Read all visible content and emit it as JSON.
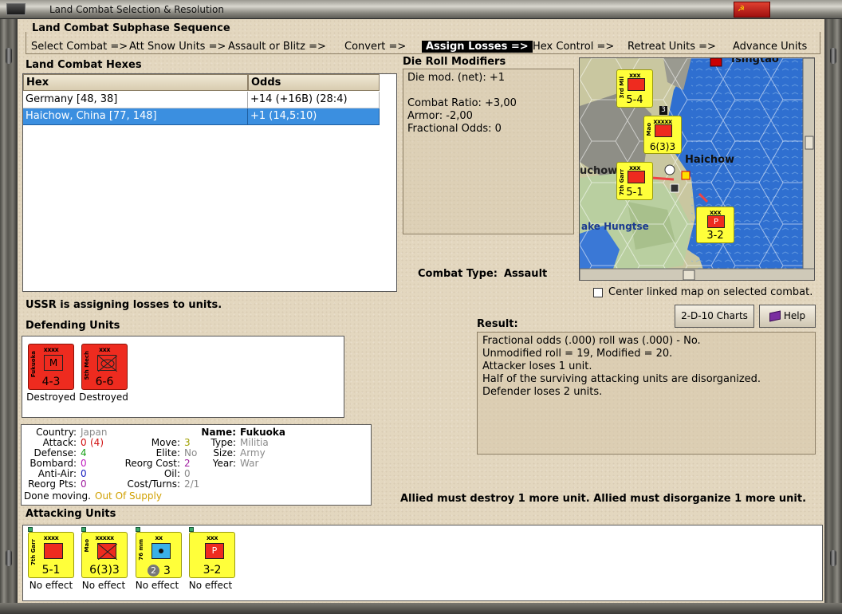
{
  "window": {
    "title": "Land Combat Selection & Resolution",
    "close_glyph": "☭"
  },
  "subphase": {
    "title": "Land Combat Subphase Sequence",
    "steps": [
      "Select Combat =>",
      "Att Snow Units =>",
      "Assault or Blitz =>",
      "Convert =>",
      "Assign Losses =>",
      "Hex Control =>",
      "Retreat Units =>",
      "Advance Units"
    ],
    "active_index": 4
  },
  "hexes": {
    "title": "Land Combat Hexes",
    "columns": [
      "Hex",
      "Odds"
    ],
    "rows": [
      {
        "hex": "Germany [48, 38]",
        "odds": "+14 (+16B) (28:4)"
      },
      {
        "hex": "Haichow, China [77, 148]",
        "odds": "+1 (14,5:10)"
      }
    ],
    "selected_row": 1
  },
  "die_roll": {
    "title": "Die Roll Modifiers",
    "lines": [
      "Die mod. (net): +1",
      "Combat Ratio: +3,00",
      "Armor: -2,00",
      "Fractional Odds: 0"
    ]
  },
  "combat_type": {
    "label": "Combat Type:",
    "value": "Assault"
  },
  "map": {
    "labels": {
      "tsingtao": "Tsingtao",
      "haichow": "Haichow",
      "uchow": "uchow",
      "hungtse": "ake Hungtse"
    },
    "units": [
      {
        "size": "xxx",
        "name": "3rd Mil",
        "str": "5-4"
      },
      {
        "size": "xxxxx",
        "name": "Mao",
        "str": "6(3)3",
        "badge": "3"
      },
      {
        "size": "xxx",
        "name": "7th Garr",
        "str": "5-1"
      },
      {
        "size": "xxx",
        "name": "",
        "str": "3-2",
        "letter": "P"
      }
    ]
  },
  "center_map": {
    "label": "Center linked map on selected combat.",
    "checked": false
  },
  "status_text": "USSR is assigning losses to units.",
  "buttons": {
    "charts": "2-D-10 Charts",
    "help": "Help"
  },
  "result": {
    "title": "Result:",
    "lines": [
      "Fractional odds (.000) roll was (.000)  -  No.",
      "Unmodified roll = 19, Modified = 20.",
      "Attacker loses 1 unit.",
      "Half of the surviving attacking units are disorganized.",
      "Defender loses 2 units."
    ]
  },
  "defending": {
    "title": "Defending Units",
    "units": [
      {
        "size": "xxxx",
        "name": "Fukuoka",
        "symbol": "M",
        "str": "4-3",
        "status": "Destroyed"
      },
      {
        "size": "xxx",
        "name": "5th Mech",
        "symbol": "",
        "str": "6-6",
        "status": "Destroyed"
      }
    ]
  },
  "unit_info": {
    "country_k": "Country:",
    "country_v": "Japan",
    "attack_k": "Attack:",
    "attack_v": "0",
    "attack_v2": "(4)",
    "defense_k": "Defense:",
    "defense_v": "4",
    "bombard_k": "Bombard:",
    "bombard_v": "0",
    "antiair_k": "Anti-Air:",
    "antiair_v": "0",
    "reorg_k": "Reorg Pts:",
    "reorg_v": "0",
    "done_k": "Done moving.",
    "done_v": "Out Of Supply",
    "move_k": "Move:",
    "move_v": "3",
    "elite_k": "Elite:",
    "elite_v": "No",
    "reorgcost_k": "Reorg Cost:",
    "reorgcost_v": "2",
    "oil_k": "Oil:",
    "oil_v": "0",
    "costturns_k": "Cost/Turns:",
    "costturns_v": "2/1",
    "name_k": "Name:",
    "name_v": "Fukuoka",
    "type_k": "Type:",
    "type_v": "Militia",
    "size_k": "Size:",
    "size_v": "Army",
    "year_k": "Year:",
    "year_v": "War"
  },
  "allied_msg": "Allied must destroy 1 more unit. Allied must disorganize 1 more unit.",
  "attacking": {
    "title": "Attacking Units",
    "units": [
      {
        "size": "xxxx",
        "name": "7th Garr",
        "str": "5-1",
        "status": "No effect",
        "color": "red"
      },
      {
        "size": "xxxxx",
        "name": "Mao",
        "str": "6(3)3",
        "status": "No effect",
        "color": "red"
      },
      {
        "size": "xx",
        "name": "76 mm",
        "str": "3",
        "badge": "2",
        "status": "No effect",
        "color": "blue"
      },
      {
        "size": "xxx",
        "name": "",
        "str": "3-2",
        "letter": "P",
        "status": "No effect",
        "color": "red"
      }
    ]
  }
}
